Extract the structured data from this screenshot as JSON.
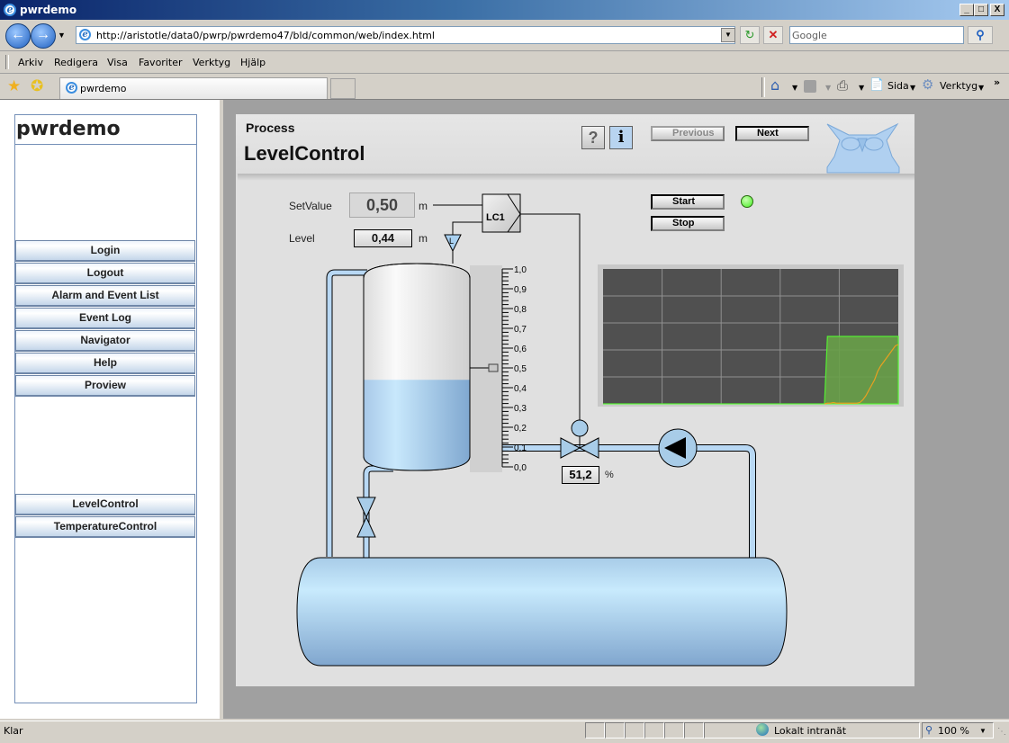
{
  "window": {
    "title": "pwrdemo",
    "controls": {
      "minimize": "_",
      "maximize": "□",
      "close": "X"
    }
  },
  "navbar": {
    "back_icon": "back-arrow-icon",
    "forward_icon": "forward-arrow-icon",
    "address": "http://aristotle/data0/pwrp/pwrdemo47/bld/common/web/index.html",
    "search_placeholder": "Google"
  },
  "menubar": {
    "items": [
      {
        "label": "Arkiv",
        "accel": "A"
      },
      {
        "label": "Redigera",
        "accel": "R"
      },
      {
        "label": "Visa",
        "accel": "s"
      },
      {
        "label": "Favoriter",
        "accel": "F"
      },
      {
        "label": "Verktyg",
        "accel": "V"
      },
      {
        "label": "Hjälp",
        "accel": "H"
      }
    ]
  },
  "tabbar": {
    "tab_label": "pwrdemo",
    "tools": {
      "page": "Sida",
      "tools": "Verktyg",
      "more": "»"
    }
  },
  "sidebar": {
    "brand": "pwrdemo",
    "menu": [
      "Login",
      "Logout",
      "Alarm and Event List",
      "Event Log",
      "Navigator",
      "Help",
      "Proview"
    ],
    "graphs": [
      "LevelControl",
      "TemperatureControl"
    ]
  },
  "process": {
    "header": "Process",
    "title": "LevelControl",
    "help_label": "?",
    "info_label": "i",
    "previous_label": "Previous",
    "next_label": "Next",
    "start_label": "Start",
    "stop_label": "Stop",
    "running_indicator_color": "#44ee22",
    "setvalue_label": "SetValue",
    "setvalue": "0,50",
    "setvalue_unit": "m",
    "level_label": "Level",
    "level": "0,44",
    "level_unit": "m",
    "controller_label": "LC1",
    "sensor_label": "L",
    "valve_opening": "51,2",
    "valve_unit": "%",
    "tank_level_fraction": 0.44,
    "setpoint_fraction": 0.5,
    "scale": [
      "1,0",
      "0,9",
      "0,8",
      "0,7",
      "0,6",
      "0,5",
      "0,4",
      "0,3",
      "0,2",
      "0,1",
      "0,0"
    ]
  },
  "trend": {
    "grid_cols": 5,
    "grid_rows": 5,
    "setpoint_series": {
      "color": "#55ee33",
      "values": [
        0,
        0,
        0,
        0,
        0,
        0,
        0,
        0,
        0,
        0,
        0,
        0,
        0,
        0,
        0,
        0,
        0,
        0,
        0,
        0,
        0,
        0,
        0,
        0,
        0,
        0,
        0,
        0,
        0,
        0,
        0,
        0,
        0,
        0,
        0,
        0,
        0,
        0,
        0,
        0,
        0,
        0,
        0,
        0,
        0,
        0,
        0,
        0,
        0,
        0,
        0,
        0,
        0,
        0,
        0,
        0,
        0,
        0,
        0,
        0,
        0,
        0,
        0,
        0,
        0,
        0,
        0,
        0,
        0,
        0,
        0,
        0,
        0,
        0,
        0,
        0,
        0.5,
        0.5,
        0.5,
        0.5,
        0.5,
        0.5,
        0.5,
        0.5,
        0.5,
        0.5,
        0.5,
        0.5,
        0.5,
        0.5,
        0.5,
        0.5,
        0.5,
        0.5,
        0.5,
        0.5,
        0.5,
        0.5,
        0.5,
        0.5,
        0.5
      ]
    },
    "level_series": {
      "color": "#e8a020",
      "values": [
        0,
        0,
        0,
        0,
        0,
        0,
        0,
        0,
        0,
        0,
        0,
        0,
        0,
        0,
        0,
        0,
        0,
        0,
        0,
        0,
        0,
        0,
        0,
        0,
        0,
        0,
        0,
        0,
        0,
        0,
        0,
        0,
        0,
        0,
        0,
        0,
        0,
        0,
        0,
        0,
        0,
        0,
        0,
        0,
        0,
        0,
        0,
        0,
        0,
        0,
        0,
        0,
        0,
        0,
        0,
        0,
        0,
        0,
        0,
        0,
        0,
        0,
        0,
        0,
        0,
        0,
        0,
        0,
        0,
        0,
        0,
        0,
        0,
        0,
        0,
        0,
        0.005,
        0.005,
        0.01,
        0.005,
        0.005,
        0.005,
        0.005,
        0.005,
        0.005,
        0.005,
        0.005,
        0.01,
        0.03,
        0.06,
        0.1,
        0.14,
        0.18,
        0.24,
        0.28,
        0.31,
        0.34,
        0.37,
        0.4,
        0.43,
        0.44
      ]
    },
    "y_range": [
      0,
      1
    ]
  },
  "statusbar": {
    "status": "Klar",
    "zone": "Lokalt intranät",
    "zoom": "100 %"
  }
}
